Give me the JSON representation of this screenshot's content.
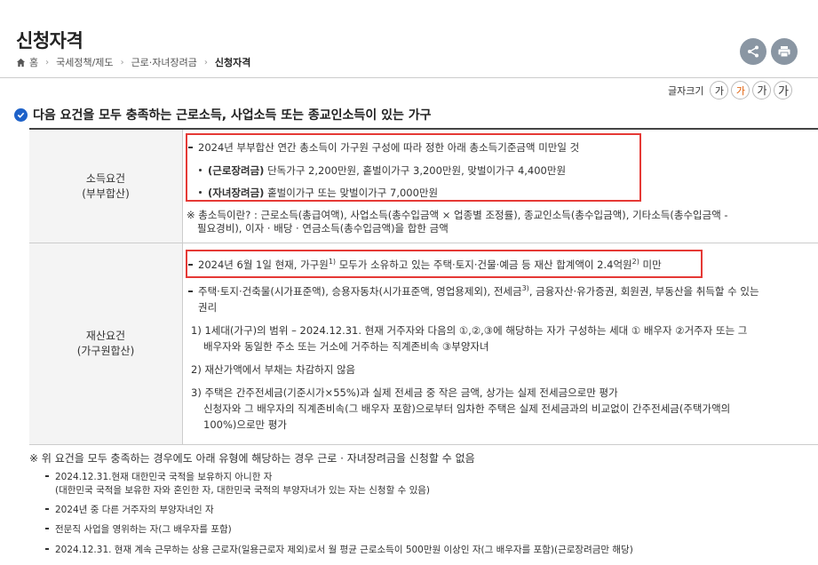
{
  "header": {
    "title": "신청자격",
    "breadcrumb": [
      "홈",
      "국세정책/제도",
      "근로·자녀장려금",
      "신청자격"
    ]
  },
  "font_size": {
    "label": "글자크기",
    "options": [
      "가",
      "가",
      "가",
      "가"
    ],
    "active_index": 1
  },
  "section": {
    "heading": "다음 요건을 모두 충족하는 근로소득, 사업소득 또는 종교인소득이 있는 가구"
  },
  "income": {
    "label_line1": "소득요건",
    "label_line2": "(부부합산)",
    "main": "2024년 부부합산 연간 총소득이 가구원 구성에 따라 정한 아래 총소득기준금액 미만일 것",
    "item1_bold": "(근로장려금)",
    "item1_text": " 단독가구 2,200만원, 홑벌이가구 3,200만원, 맞벌이가구 4,400만원",
    "item2_bold": "(자녀장려금)",
    "item2_text": " 홑벌이가구 또는 맞벌이가구 7,000만원",
    "note_line1": "※ 총소득이란? : 근로소득(총급여액), 사업소득(총수입금액 × 업종별 조정률), 종교인소득(총수입금액), 기타소득(총수입금액 -",
    "note_line2": "필요경비), 이자 · 배당 · 연금소득(총수입금액)을 합한 금액"
  },
  "asset": {
    "label_line1": "재산요건",
    "label_line2": "(가구원합산)",
    "main_pre": "2024년 6월 1일 현재, 가구원",
    "main_sup1": "1)",
    "main_mid": " 모두가 소유하고 있는 주택·토지·건물·예금 등 재산 합계액이 2.4억원",
    "main_sup2": "2)",
    "main_post": " 미만",
    "sub_pre": "주택·토지·건축물(시가표준액), 승용자동차(시가표준액, 영업용제외), 전세금",
    "sub_sup": "3)",
    "sub_post": ", 금융자산·유가증권, 회원권, 부동산을 취득할 수 있는",
    "sub_line2": "권리",
    "fn1_line1": "1) 1세대(가구)의 범위 – 2024.12.31. 현재 거주자와 다음의 ①,②,③에 해당하는 자가 구성하는 세대 ① 배우자 ②거주자 또는 그",
    "fn1_line2": "배우자와 동일한 주소 또는 거소에 거주하는 직계존비속 ③부양자녀",
    "fn2": "2) 재산가액에서 부채는 차감하지 않음",
    "fn3_line1": "3) 주택은 간주전세금(기준시가×55%)과 실제 전세금 중 작은 금액, 상가는 실제 전세금으로만 평가",
    "fn3_line2": "신청자와 그 배우자의 직계존비속(그 배우자 포함)으로부터 임차한 주택은 실제 전세금과의 비교없이 간주전세금(주택가액의",
    "fn3_line3": "100%)으로만 평가"
  },
  "exclusion": {
    "note": "※ 위 요건을 모두 충족하는 경우에도 아래 유형에 해당하는 경우 근로 · 자녀장려금을 신청할 수 없음",
    "items": [
      "2024.12.31.현재 대한민국 국적을 보유하지 아니한 자",
      "(대한민국 국적을 보유한 자와 혼인한 자, 대한민국 국적의 부양자녀가 있는 자는 신청할 수 있음)",
      "2024년 중 다른 거주자의 부양자녀인 자",
      "전문직 사업을 영위하는 자(그 배우자를 포함)",
      "2024.12.31. 현재 계속 근무하는 상용 근로자(일용근로자 제외)로서 월 평균 근로소득이 500만원 이상인 자(그 배우자를 포함)(근로장려금만 해당)"
    ]
  }
}
